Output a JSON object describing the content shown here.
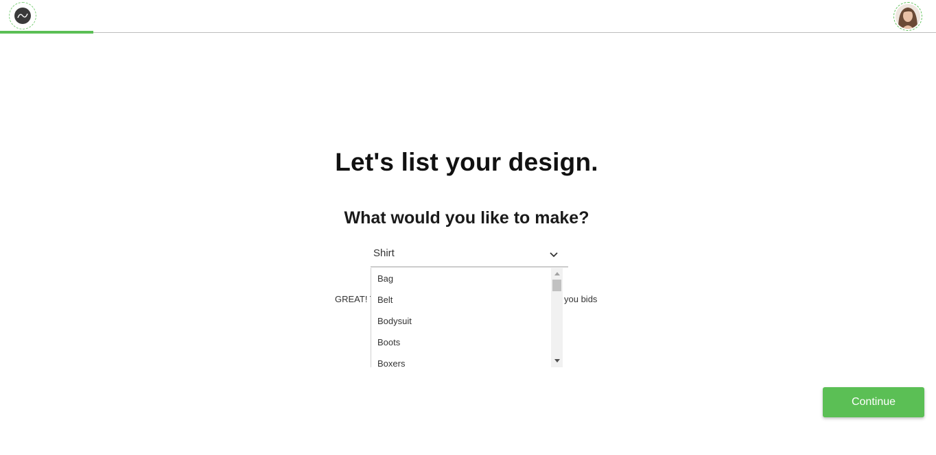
{
  "header": {
    "logo_icon": "brand-logo-icon",
    "avatar_icon": "user-avatar-icon",
    "progress_percent": 10
  },
  "main": {
    "title": "Let's list your design.",
    "question": "What would you like to make?",
    "select": {
      "value": "Shirt",
      "chevron_icon": "chevron-down-icon"
    },
    "hint_left": "GREAT! T",
    "hint_right": "you bids",
    "dropdown": {
      "options": [
        "Bag",
        "Belt",
        "Bodysuit",
        "Boots",
        "Boxers"
      ],
      "scroll_up_icon": "scroll-up-arrow-icon",
      "scroll_down_icon": "scroll-down-arrow-icon"
    }
  },
  "footer": {
    "continue_label": "Continue"
  },
  "colors": {
    "accent": "#5bbf55",
    "text": "#111111",
    "divider": "#bdbdbd"
  }
}
